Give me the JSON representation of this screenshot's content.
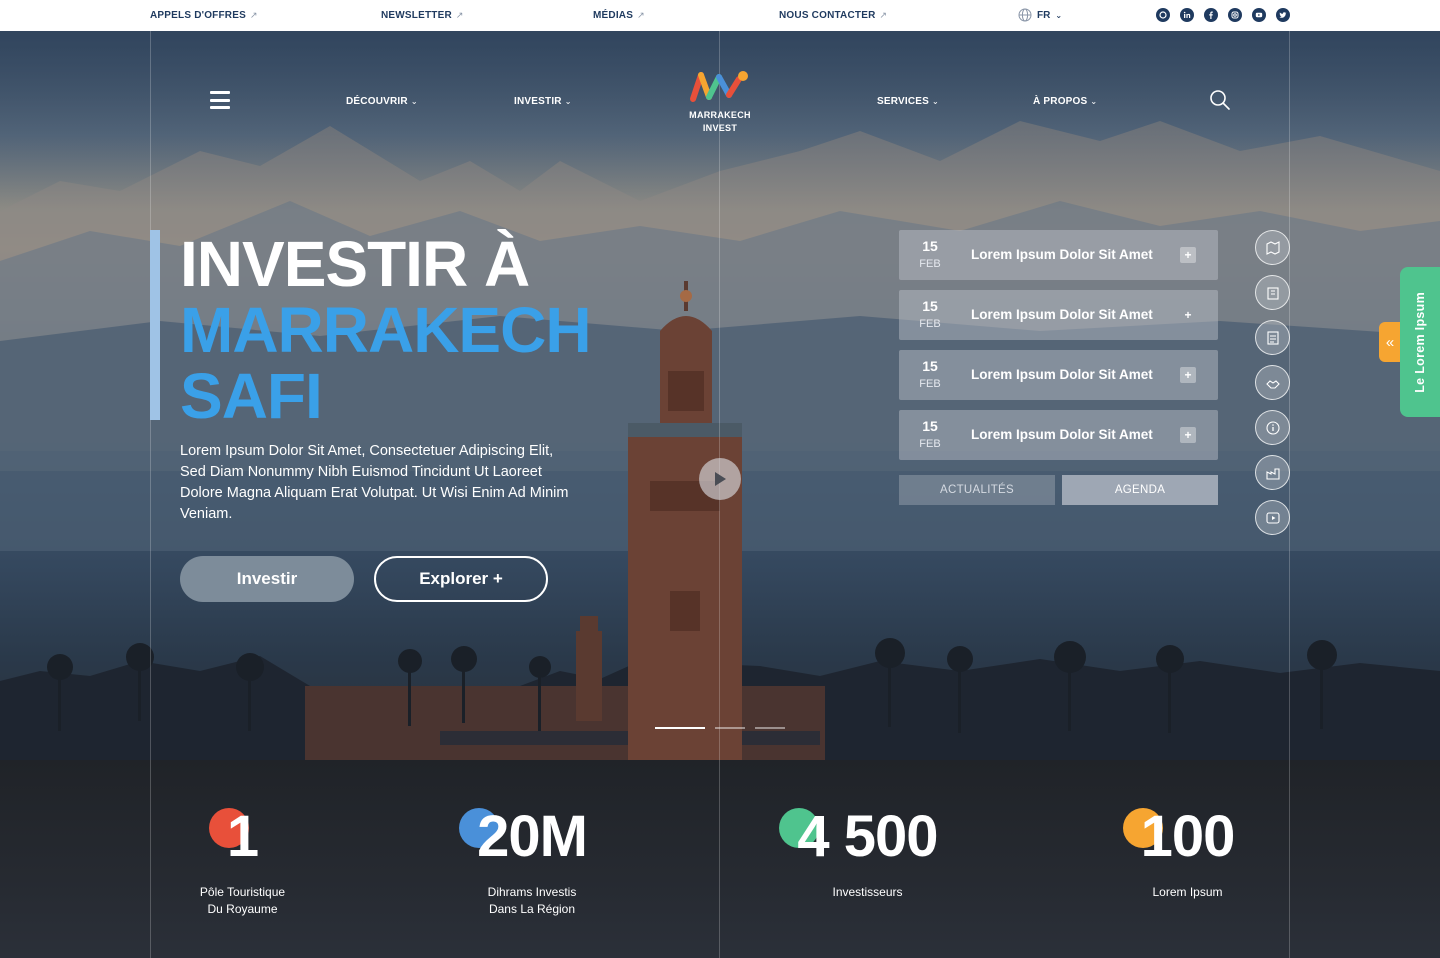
{
  "topbar": {
    "links": [
      {
        "label": "APPELS D'OFFRES",
        "arrow": "↗"
      },
      {
        "label": "NEWSLETTER",
        "arrow": "↗"
      },
      {
        "label": "MÉDIAS",
        "arrow": "↗"
      },
      {
        "label": "NOUS CONTACTER",
        "arrow": "↗"
      }
    ],
    "language": "FR",
    "social_icons": [
      "whatsapp-icon",
      "linkedin-icon",
      "facebook-icon",
      "instagram-icon",
      "youtube-icon",
      "twitter-icon"
    ]
  },
  "nav": {
    "items": [
      {
        "label": "DÉCOUVRIR"
      },
      {
        "label": "INVESTIR"
      },
      {
        "label": "SERVICES"
      },
      {
        "label": "À PROPOS"
      }
    ],
    "chevron": "⌄",
    "logo": {
      "line1": "MARRAKECH",
      "line2": "INVEST"
    }
  },
  "hero": {
    "headline_line1": "INVESTIR À",
    "headline_line2": "MARRAKECH",
    "headline_line3": "SAFI",
    "lede": "Lorem Ipsum Dolor Sit Amet, Consectetuer Adipiscing Elit, Sed Diam Nonummy Nibh Euismod Tincidunt Ut Laoreet Dolore Magna Aliquam Erat Volutpat. Ut Wisi Enim Ad Minim Veniam.",
    "btn_primary": "Investir",
    "btn_secondary": "Explorer +",
    "slides_total": 3,
    "slide_active": 1
  },
  "events": [
    {
      "day": "15",
      "month": "FEB",
      "title": "Lorem Ipsum Dolor Sit Amet",
      "plus": "+"
    },
    {
      "day": "15",
      "month": "FEB",
      "title": "Lorem Ipsum Dolor Sit Amet",
      "plus": "+"
    },
    {
      "day": "15",
      "month": "FEB",
      "title": "Lorem Ipsum Dolor Sit Amet",
      "plus": "+"
    },
    {
      "day": "15",
      "month": "FEB",
      "title": "Lorem Ipsum Dolor Sit Amet",
      "plus": "+"
    }
  ],
  "event_tabs": {
    "actualites": "ACTUALITÉS",
    "agenda": "AGENDA"
  },
  "side_icons": [
    "map-icon",
    "building-icon",
    "document-icon",
    "handshake-icon",
    "info-icon",
    "factory-icon",
    "video-icon"
  ],
  "slide_tab": {
    "chevron": "«",
    "label": "Le Lorem Ipsum"
  },
  "stats": [
    {
      "value": "1",
      "label_line1": "Pôle Touristique",
      "label_line2": "Du Royaume",
      "color": "#e8503a"
    },
    {
      "value": "20M",
      "label_line1": "Dihrams Investis",
      "label_line2": "Dans La Région",
      "color": "#4a90d9"
    },
    {
      "value": "4 500",
      "label_line1": "Investisseurs",
      "label_line2": "",
      "color": "#4fc48e"
    },
    {
      "value": "100",
      "label_line1": "Lorem Ipsum",
      "label_line2": "",
      "color": "#f6a531"
    }
  ],
  "colors": {
    "accent_blue": "#3aa0e8",
    "accent_bar": "#9fc3e6",
    "navy": "#1f3a5f",
    "green": "#4fc48e",
    "orange": "#f6a531"
  }
}
